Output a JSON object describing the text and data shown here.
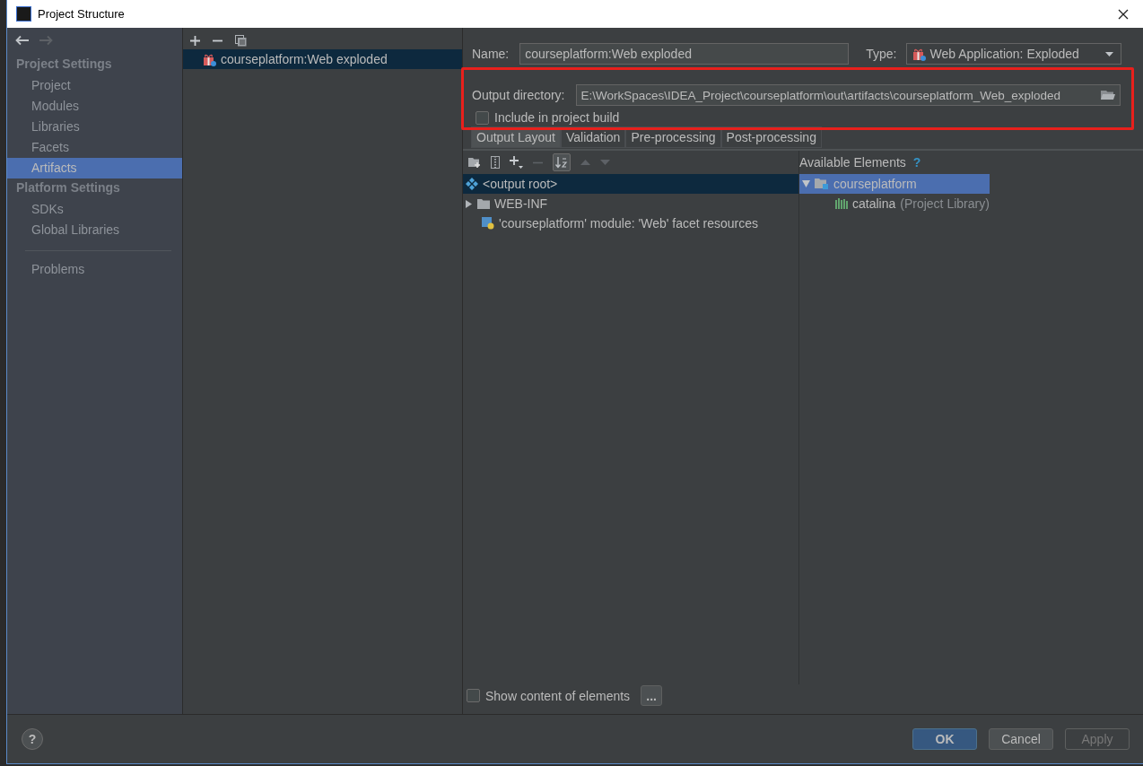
{
  "window": {
    "title": "Project Structure"
  },
  "sidebar": {
    "sections": [
      {
        "heading": "Project Settings",
        "items": [
          {
            "label": "Project",
            "selected": false
          },
          {
            "label": "Modules",
            "selected": false
          },
          {
            "label": "Libraries",
            "selected": false
          },
          {
            "label": "Facets",
            "selected": false
          },
          {
            "label": "Artifacts",
            "selected": true
          }
        ]
      },
      {
        "heading": "Platform Settings",
        "items": [
          {
            "label": "SDKs",
            "selected": false
          },
          {
            "label": "Global Libraries",
            "selected": false
          }
        ]
      }
    ],
    "extra_items": [
      {
        "label": "Problems",
        "selected": false
      }
    ]
  },
  "artifacts": [
    {
      "name": "courseplatform:Web exploded",
      "selected": true
    }
  ],
  "form": {
    "name_label": "Name:",
    "name_value": "courseplatform:Web exploded",
    "type_label": "Type:",
    "type_value": "Web Application: Exploded",
    "output_label": "Output directory:",
    "output_value": "E:\\WorkSpaces\\IDEA_Project\\courseplatform\\out\\artifacts\\courseplatform_Web_exploded",
    "include": {
      "label": "Include in project build",
      "checked": false
    }
  },
  "tabs": [
    {
      "label": "Output Layout",
      "selected": true
    },
    {
      "label": "Validation",
      "selected": false
    },
    {
      "label": "Pre-processing",
      "selected": false
    },
    {
      "label": "Post-processing",
      "selected": false
    }
  ],
  "layout_tree": [
    {
      "kind": "root",
      "label": "<output root>",
      "selected": true
    },
    {
      "kind": "folder",
      "label": "WEB-INF",
      "selected": false,
      "expanded": false
    },
    {
      "kind": "facet",
      "label": "'courseplatform' module: 'Web' facet resources",
      "selected": false
    }
  ],
  "available": {
    "heading": "Available Elements",
    "help": "?",
    "tree": [
      {
        "label": "courseplatform",
        "selected": true,
        "expanded": true,
        "children": [
          {
            "label": "catalina",
            "note": "(Project Library)",
            "selected": false
          }
        ]
      }
    ]
  },
  "show_content": {
    "label": "Show content of elements",
    "checked": false
  },
  "more_button": "...",
  "help": "?",
  "buttons": [
    {
      "label": "OK",
      "kind": "default",
      "disabled": false
    },
    {
      "label": "Cancel",
      "kind": "normal",
      "disabled": false
    },
    {
      "label": "Apply",
      "kind": "normal",
      "disabled": true
    }
  ],
  "annotation": {
    "kind": "highlight"
  }
}
